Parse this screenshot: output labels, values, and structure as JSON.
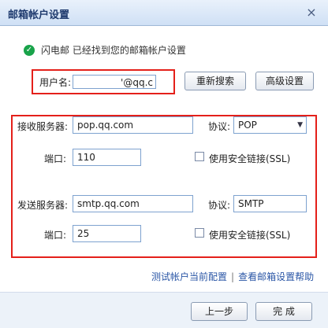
{
  "window": {
    "title": "邮箱帐户设置",
    "close_label": "×"
  },
  "status": {
    "text": "闪电邮 已经找到您的邮箱帐户设置"
  },
  "user": {
    "label": "用户名:",
    "value": "'@qq.c"
  },
  "buttons": {
    "search": "重新搜索",
    "advanced": "高级设置",
    "prev": "上一步",
    "finish": "完 成"
  },
  "incoming": {
    "label": "接收服务器:",
    "server": "pop.qq.com",
    "protocol_label": "协议:",
    "protocol": "POP",
    "port_label": "端口:",
    "port": "110",
    "ssl_label": "使用安全链接(SSL)",
    "ssl_checked": false
  },
  "outgoing": {
    "label": "发送服务器:",
    "server": "smtp.qq.com",
    "protocol_label": "协议:",
    "protocol": "SMTP",
    "port_label": "端口:",
    "port": "25",
    "ssl_label": "使用安全链接(SSL)",
    "ssl_checked": false
  },
  "links": {
    "test": "测试帐户当前配置",
    "sep": "|",
    "help": "查看邮箱设置帮助"
  },
  "icons": {
    "check": "check-circle-icon",
    "close": "close-icon",
    "dropdown": "chevron-down-icon"
  },
  "colors": {
    "highlight": "#e4201a",
    "link": "#2a56a6",
    "success": "#19a34a"
  }
}
